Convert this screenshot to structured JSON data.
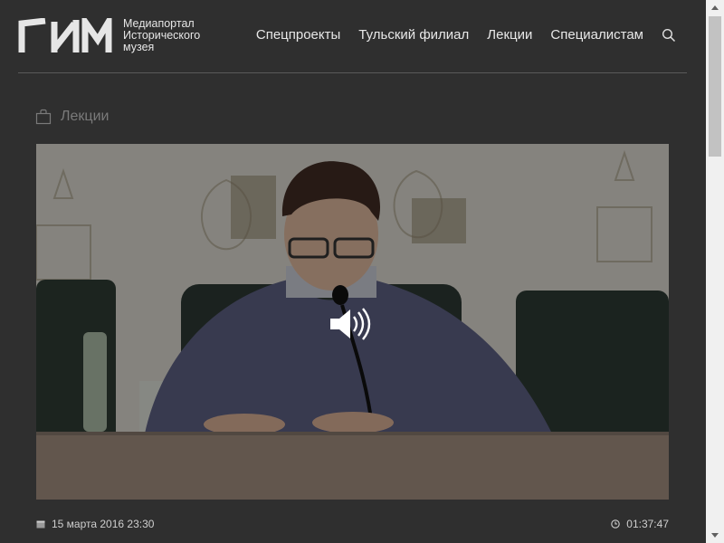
{
  "header": {
    "logo_text": "Медиапортал Исторического музея",
    "nav": [
      "Спецпроекты",
      "Тульский филиал",
      "Лекции",
      "Специалистам"
    ]
  },
  "section": {
    "label": "Лекции"
  },
  "video": {
    "date": "15 марта 2016 23:30",
    "duration": "01:37:47"
  },
  "icons": {
    "search": "search-icon",
    "section": "bag-icon",
    "sound": "speaker-icon",
    "date": "calendar-icon",
    "duration": "clock-icon"
  },
  "colors": {
    "background": "#2f2f2f",
    "text": "#e8e8e8",
    "muted": "#7a7a7a",
    "divider": "#5a5a5a"
  }
}
